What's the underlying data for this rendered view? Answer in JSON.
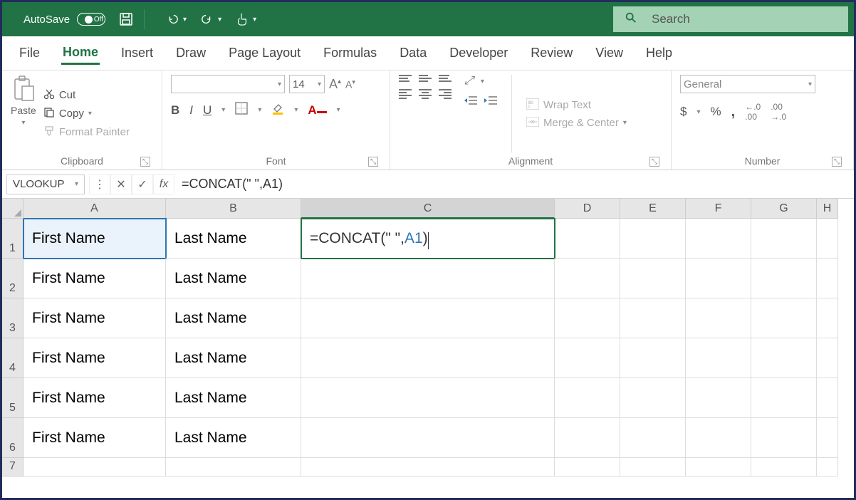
{
  "titlebar": {
    "autosave_label": "AutoSave",
    "autosave_state": "Off",
    "search_placeholder": "Search"
  },
  "tabs": {
    "file": "File",
    "home": "Home",
    "insert": "Insert",
    "draw": "Draw",
    "page_layout": "Page Layout",
    "formulas": "Formulas",
    "data": "Data",
    "developer": "Developer",
    "review": "Review",
    "view": "View",
    "help": "Help"
  },
  "ribbon": {
    "clipboard": {
      "paste": "Paste",
      "cut": "Cut",
      "copy": "Copy",
      "format_painter": "Format Painter",
      "label": "Clipboard"
    },
    "font": {
      "size": "14",
      "bold": "B",
      "italic": "I",
      "underline": "U",
      "label": "Font",
      "bigA": "A",
      "smallA": "A"
    },
    "alignment": {
      "wrap": "Wrap Text",
      "merge": "Merge & Center",
      "label": "Alignment"
    },
    "number": {
      "format": "General",
      "dollar": "$",
      "percent": "%",
      "comma": "🡒",
      "label": "Number"
    }
  },
  "formulabar": {
    "namebox": "VLOOKUP",
    "formula": "=CONCAT(\"       \",A1)"
  },
  "grid": {
    "cols": [
      "A",
      "B",
      "C",
      "D",
      "E",
      "F",
      "G",
      "H"
    ],
    "rows": [
      "1",
      "2",
      "3",
      "4",
      "5",
      "6",
      "7"
    ],
    "a": [
      "First Name",
      "First Name",
      "First Name",
      "First Name",
      "First Name",
      "First Name"
    ],
    "b": [
      "Last Name",
      "Last Name",
      "Last Name",
      "Last Name",
      "Last Name",
      "Last Name"
    ],
    "c1_p1": "=CONCAT(\"        \",",
    "c1_ref": "A1",
    "c1_p3": ")"
  }
}
